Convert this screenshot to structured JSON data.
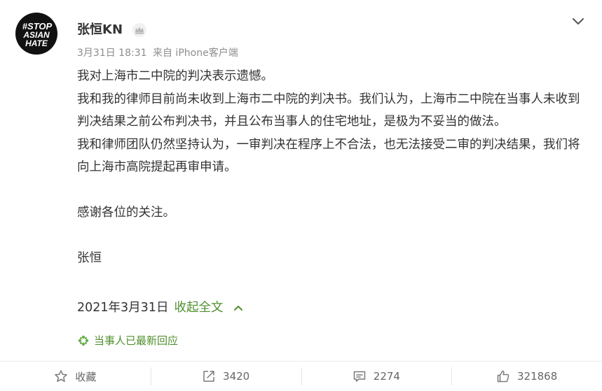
{
  "post": {
    "author": "张恒KN",
    "avatar_text": [
      "#STOP",
      "ASIAN",
      "HATE"
    ],
    "badge_icon": "crown-icon",
    "date": "3月31日 18:31",
    "source": "来自 iPhone客户端",
    "paragraphs": [
      "我对上海市二中院的判决表示遗憾。",
      "我和我的律师目前尚未收到上海市二中院的判决书。我们认为，上海市二中院在当事人未收到判决结果之前公布判决书，并且公布当事人的住宅地址，是极为不妥当的做法。",
      "我和律师团队仍然坚持认为，一审判决在程序上不合法，也无法接受二审的判决结果，我们将向上海市高院提起再审申请。",
      "",
      "感谢各位的关注。",
      "",
      "张恒"
    ],
    "sign_date": "2021年3月31日",
    "collapse_label": "收起全文",
    "notice": "当事人已最新回应"
  },
  "actions": {
    "favorite": {
      "label": "收藏",
      "icon": "star-icon"
    },
    "repost": {
      "label": "3420",
      "icon": "share-icon"
    },
    "comment": {
      "label": "2274",
      "icon": "comment-icon"
    },
    "like": {
      "label": "321868",
      "icon": "thumbs-up-icon"
    }
  },
  "colors": {
    "accent_green": "#4f8f2e",
    "meta_gray": "#8d8d8d",
    "text": "#333333"
  }
}
